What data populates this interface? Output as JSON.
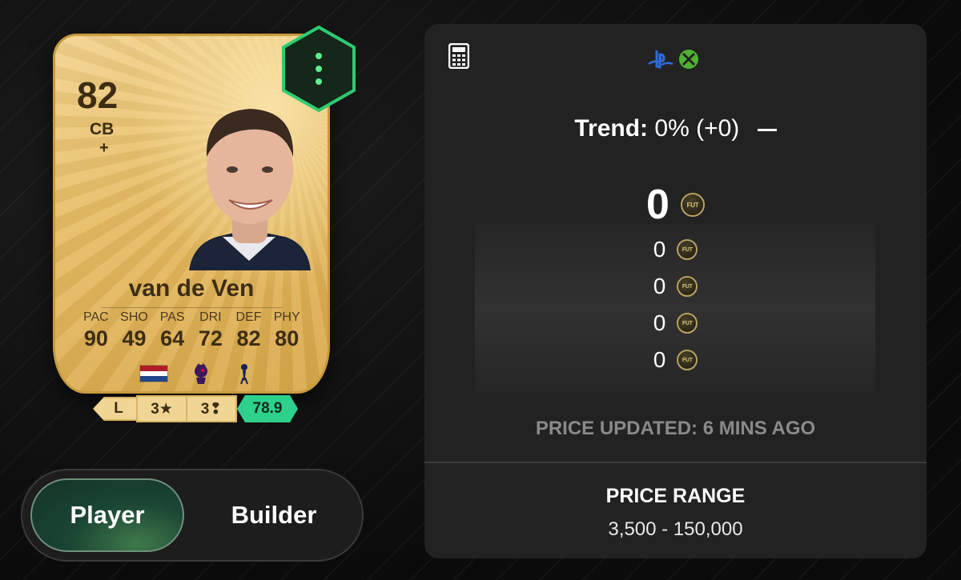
{
  "card": {
    "rating": "82",
    "position": "CB",
    "plus": "+",
    "name": "van de Ven",
    "stats": [
      {
        "label": "PAC",
        "value": "90"
      },
      {
        "label": "SHO",
        "value": "49"
      },
      {
        "label": "PAS",
        "value": "64"
      },
      {
        "label": "DRI",
        "value": "72"
      },
      {
        "label": "DEF",
        "value": "82"
      },
      {
        "label": "PHY",
        "value": "80"
      }
    ],
    "nation": "netherlands-flag",
    "league": "premier-league-icon",
    "club": "tottenham-icon",
    "colors": {
      "gold": "#e6bb62",
      "text": "#3d2d14"
    }
  },
  "chips": {
    "foot": "L",
    "skill_moves": "3★",
    "weak_foot": "3❢",
    "rating": "78.9",
    "rating_color": "#2ed18b"
  },
  "menu_icon": "more-vertical-icon",
  "toggle": {
    "player_label": "Player",
    "builder_label": "Builder",
    "active": "Player"
  },
  "panel": {
    "calculator_icon": "calculator-icon",
    "platforms": [
      "playstation-icon",
      "xbox-icon"
    ],
    "trend_label": "Trend:",
    "trend_value": "0% (+0)",
    "trend_indicator": "—",
    "main_price": "0",
    "prices": [
      "0",
      "0",
      "0",
      "0"
    ],
    "coin_text": "FUT",
    "updated": "PRICE UPDATED: 6 MINS AGO",
    "range_title": "PRICE RANGE",
    "range_value": "3,500 - 150,000"
  }
}
